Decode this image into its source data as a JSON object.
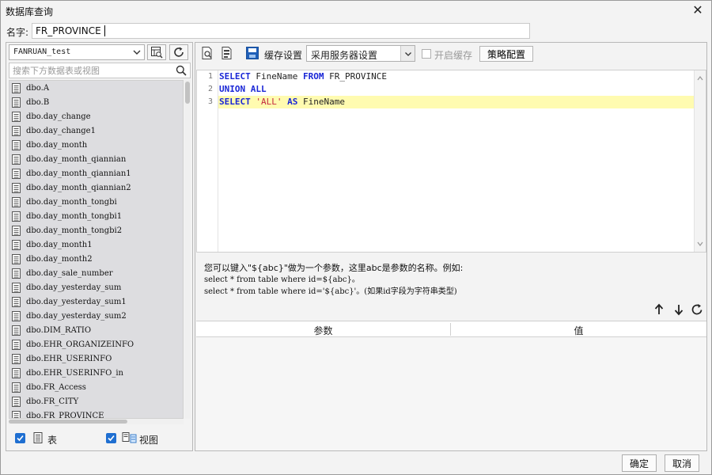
{
  "window": {
    "title": "数据库查询"
  },
  "name_field": {
    "label": "名字:",
    "value": "FR_PROVINCE"
  },
  "left_panel": {
    "connection": "FANRUAN_test",
    "search_placeholder": "搜索下方数据表或视图",
    "tables": [
      "dbo.A",
      "dbo.B",
      "dbo.day_change",
      "dbo.day_change1",
      "dbo.day_month",
      "dbo.day_month_qiannian",
      "dbo.day_month_qiannian1",
      "dbo.day_month_qiannian2",
      "dbo.day_month_tongbi",
      "dbo.day_month_tongbi1",
      "dbo.day_month_tongbi2",
      "dbo.day_month1",
      "dbo.day_month2",
      "dbo.day_sale_number",
      "dbo.day_yesterday_sum",
      "dbo.day_yesterday_sum1",
      "dbo.day_yesterday_sum2",
      "dbo.DIM_RATIO",
      "dbo.EHR_ORGANIZEINFO",
      "dbo.EHR_USERINFO",
      "dbo.EHR_USERINFO_in",
      "dbo.FR_Access",
      "dbo.FR_CITY",
      "dbo.FR_PROVINCE"
    ],
    "show_tables_label": "表",
    "show_views_label": "视图",
    "show_tables_checked": true,
    "show_views_checked": true
  },
  "toolbar": {
    "cache_settings_label": "缓存设置",
    "cache_mode": "采用服务器设置",
    "enable_cache_label": "开启缓存",
    "enable_cache_checked": false,
    "strategy_button": "策略配置"
  },
  "editor": {
    "line_numbers": [
      "1",
      "2",
      "3"
    ],
    "current_line": 3
  },
  "hint": {
    "line1": "您可以键入\"${abc}\"做为一个参数，这里abc是参数的名称。例如:",
    "line2": "select * from table where id=${abc}。",
    "line3": "select * from table where id='${abc}'。(如果id字段为字符串类型)"
  },
  "param_table": {
    "col_param": "参数",
    "col_value": "值"
  },
  "buttons": {
    "ok": "确定",
    "cancel": "取消"
  },
  "colors": {
    "checkbox_accent": "#1f6fd1",
    "keyword": "#1a27d6",
    "string": "#c4283e",
    "current_line": "#fffbb0"
  }
}
